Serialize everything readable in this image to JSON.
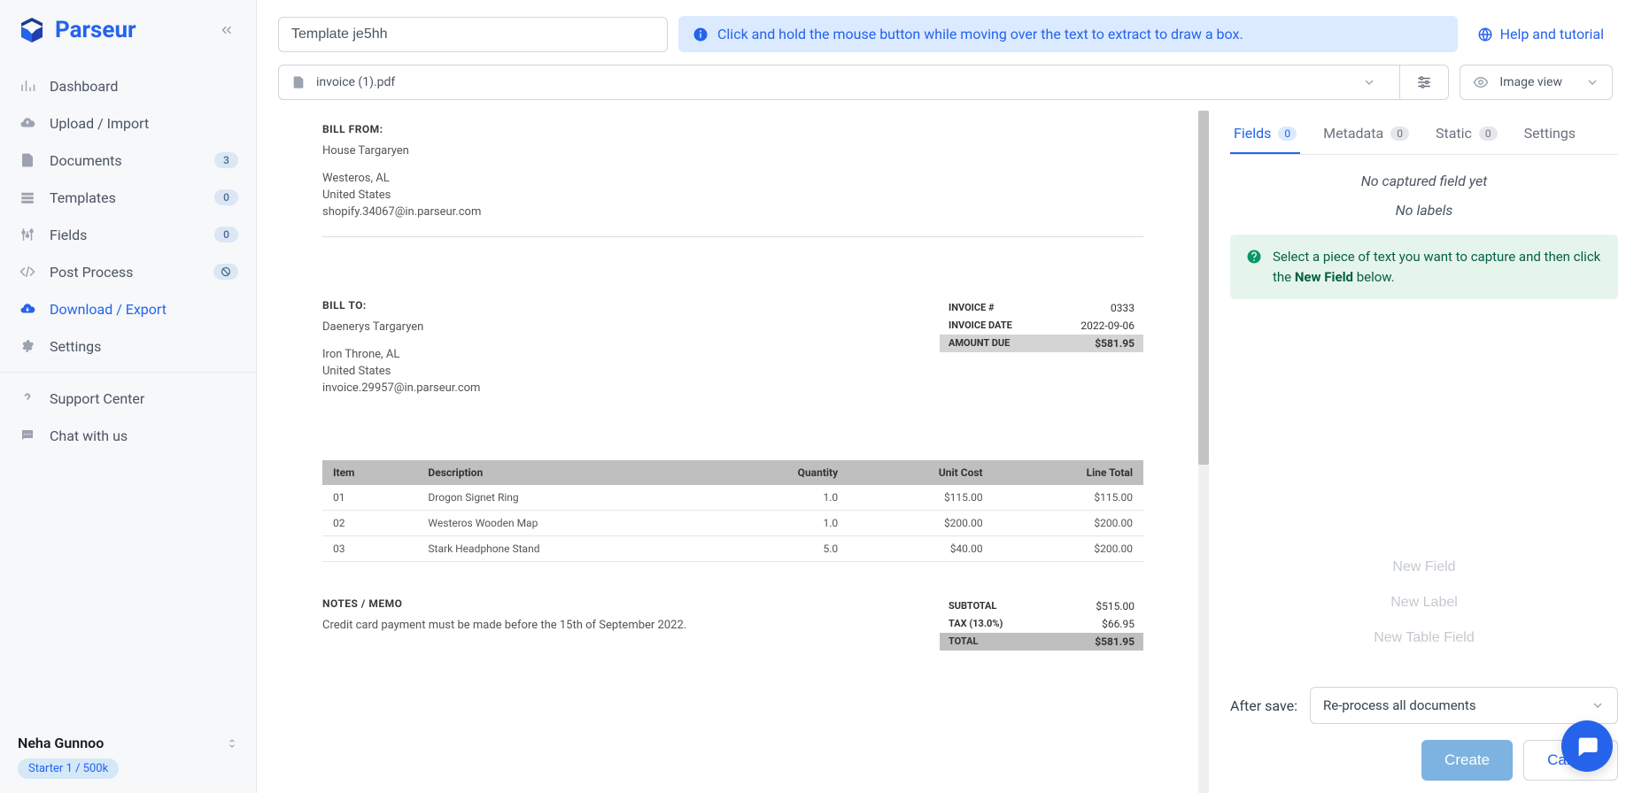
{
  "brand": "Parseur",
  "sidebar": {
    "items": [
      {
        "label": "Dashboard",
        "badge": null
      },
      {
        "label": "Upload / Import",
        "badge": null
      },
      {
        "label": "Documents",
        "badge": "3"
      },
      {
        "label": "Templates",
        "badge": "0"
      },
      {
        "label": "Fields",
        "badge": "0"
      },
      {
        "label": "Post Process",
        "badge_icon": true
      },
      {
        "label": "Download / Export",
        "badge": null,
        "active": true
      },
      {
        "label": "Settings",
        "badge": null
      }
    ],
    "support": [
      {
        "label": "Support Center"
      },
      {
        "label": "Chat with us"
      }
    ],
    "user": {
      "name": "Neha Gunnoo",
      "plan": "Starter 1 / 500k"
    }
  },
  "topbar": {
    "template_name": "Template je5hh",
    "info_banner": "Click and hold the mouse button while moving over the text to extract to draw a box.",
    "help_link": "Help and tutorial",
    "file_name": "invoice (1).pdf",
    "view_mode": "Image view"
  },
  "invoice": {
    "bill_from_label": "BILL FROM:",
    "bill_from": {
      "name": "House Targaryen",
      "addr1": "Westeros, AL",
      "addr2": "United States",
      "email": "shopify.34067@in.parseur.com"
    },
    "bill_to_label": "BILL TO:",
    "bill_to": {
      "name": "Daenerys Targaryen",
      "addr1": "Iron Throne, AL",
      "addr2": "United States",
      "email": "invoice.29957@in.parseur.com"
    },
    "meta": [
      {
        "label": "INVOICE #",
        "value": "0333"
      },
      {
        "label": "INVOICE DATE",
        "value": "2022-09-06"
      },
      {
        "label": "AMOUNT DUE",
        "value": "$581.95",
        "hl": true
      }
    ],
    "columns": {
      "item": "Item",
      "desc": "Description",
      "qty": "Quantity",
      "unit": "Unit Cost",
      "total": "Line Total"
    },
    "lines": [
      {
        "item": "01",
        "desc": "Drogon Signet Ring",
        "qty": "1.0",
        "unit": "$115.00",
        "total": "$115.00"
      },
      {
        "item": "02",
        "desc": "Westeros Wooden Map",
        "qty": "1.0",
        "unit": "$200.00",
        "total": "$200.00"
      },
      {
        "item": "03",
        "desc": "Stark Headphone Stand",
        "qty": "5.0",
        "unit": "$40.00",
        "total": "$200.00"
      }
    ],
    "notes_label": "NOTES / MEMO",
    "notes": "Credit card payment must be made before the 15th of September 2022.",
    "totals": [
      {
        "label": "SUBTOTAL",
        "value": "$515.00"
      },
      {
        "label": "TAX (13.0%)",
        "value": "$66.95"
      },
      {
        "label": "TOTAL",
        "value": "$581.95",
        "hl": true
      }
    ]
  },
  "panel": {
    "tabs": [
      {
        "label": "Fields",
        "count": "0",
        "active": true
      },
      {
        "label": "Metadata",
        "count": "0"
      },
      {
        "label": "Static",
        "count": "0"
      },
      {
        "label": "Settings",
        "count": null
      }
    ],
    "empty1": "No captured field yet",
    "empty2": "No labels",
    "tip_pre": "Select a piece of text you want to capture and then click the ",
    "tip_bold": "New Field",
    "tip_post": " below.",
    "buttons": {
      "new_field": "New Field",
      "new_label": "New Label",
      "new_table": "New Table Field"
    },
    "after_save_label": "After save:",
    "after_save_value": "Re-process all documents",
    "create": "Create",
    "cancel": "Cancel"
  }
}
